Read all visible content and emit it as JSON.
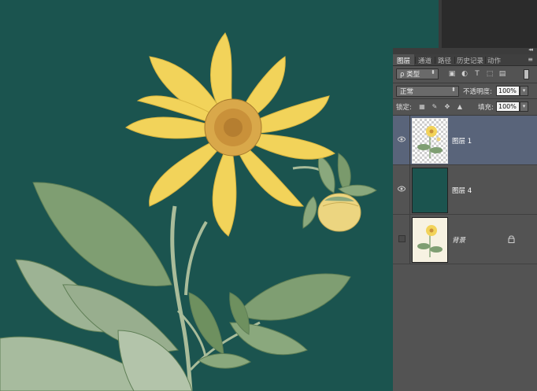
{
  "colors": {
    "canvas_bg": "#1b544f",
    "panel_bg": "#535353",
    "selected_layer": "#59647a",
    "petal": "#f2d35a",
    "leaf": "#7f9e72"
  },
  "panel": {
    "tabs": [
      {
        "label": "图层",
        "active": true
      },
      {
        "label": "通道",
        "active": false
      },
      {
        "label": "路径",
        "active": false
      },
      {
        "label": "历史记录",
        "active": false
      },
      {
        "label": "动作",
        "active": false
      }
    ],
    "menu_icon": "panel-menu-icon",
    "filter": {
      "kind_label": "ρ 类型",
      "icons": [
        "image-filter-icon",
        "adjustment-filter-icon",
        "type-filter-icon",
        "shape-filter-icon",
        "smart-object-filter-icon"
      ]
    },
    "blend": {
      "mode": "正常",
      "opacity_label": "不透明度:",
      "opacity_value": "100%"
    },
    "lock": {
      "label": "锁定:",
      "icons": [
        "lock-transparent-icon",
        "lock-paint-icon",
        "lock-move-icon",
        "lock-all-icon"
      ],
      "fill_label": "填充:",
      "fill_value": "100%"
    },
    "layers": [
      {
        "name": "图层 1",
        "visible": true,
        "selected": true,
        "thumb": "flower-transparent"
      },
      {
        "name": "图层 4",
        "visible": true,
        "selected": false,
        "thumb": "solid-teal"
      },
      {
        "name": "背景",
        "visible": false,
        "selected": false,
        "thumb": "flower-on-cream",
        "locked": true
      }
    ]
  }
}
